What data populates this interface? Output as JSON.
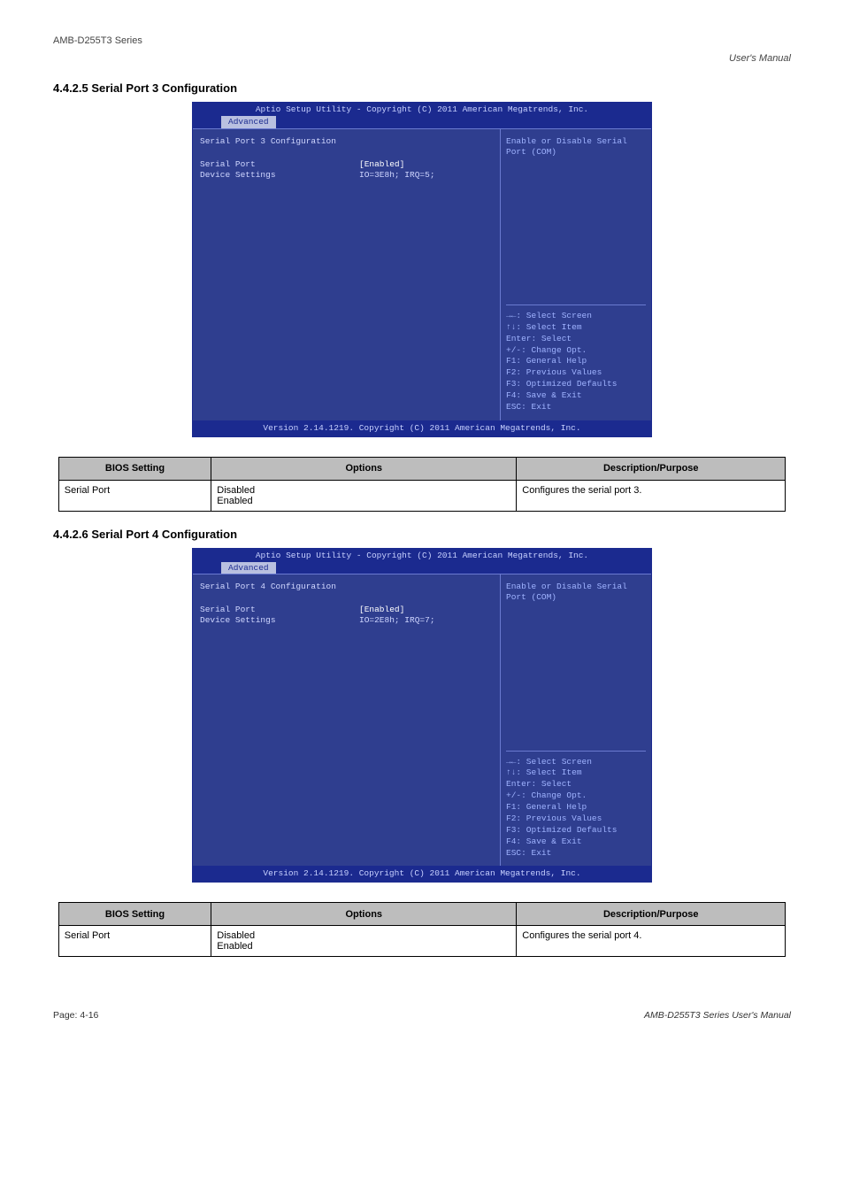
{
  "page_header": "AMB-D255T3 Series",
  "user_manual": "User's Manual",
  "section1_title": "4.4.2.5 Serial Port 3 Configuration",
  "section2_title": "4.4.2.6 Serial Port 4 Configuration",
  "bios_top": "Aptio Setup Utility - Copyright (C) 2011 American Megatrends, Inc.",
  "bios_tab": "Advanced",
  "bios_footer": "Version 2.14.1219. Copyright (C) 2011 American Megatrends, Inc.",
  "bios3": {
    "title": "Serial Port 3 Configuration",
    "serial_port_label": "Serial Port",
    "serial_port_value": "[Enabled]",
    "dev_label": "Device Settings",
    "dev_value": "IO=3E8h; IRQ=5;",
    "hint": "Enable or Disable Serial Port (COM)"
  },
  "bios4": {
    "title": "Serial Port 4 Configuration",
    "serial_port_label": "Serial Port",
    "serial_port_value": "[Enabled]",
    "dev_label": "Device Settings",
    "dev_value": "IO=2E8h; IRQ=7;",
    "hint": "Enable or Disable Serial Port (COM)"
  },
  "keys": {
    "k1": "→←: Select Screen",
    "k2": "↑↓: Select Item",
    "k3": "Enter: Select",
    "k4": "+/-: Change Opt.",
    "k5": "F1: General Help",
    "k6": "F2: Previous Values",
    "k7": "F3: Optimized Defaults",
    "k8": "F4: Save & Exit",
    "k9": "ESC: Exit"
  },
  "table3": {
    "h1": "BIOS Setting",
    "h2": "Options",
    "h3": "Description/Purpose",
    "c1": "Serial Port",
    "c2": "Disabled\nEnabled",
    "c3": "Configures the serial port 3."
  },
  "table4": {
    "h1": "BIOS Setting",
    "h2": "Options",
    "h3": "Description/Purpose",
    "c1": "Serial Port",
    "c2": "Disabled\nEnabled",
    "c3": "Configures the serial port 4."
  },
  "footer_left": "Page: 4-16",
  "footer_right": "AMB-D255T3 Series User's Manual"
}
